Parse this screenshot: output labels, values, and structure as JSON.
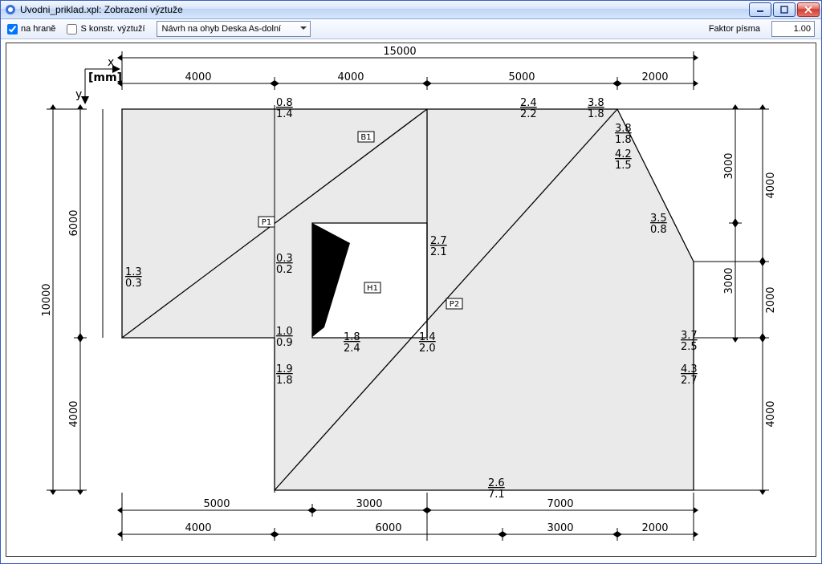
{
  "window": {
    "title": "Uvodni_priklad.xpl: Zobrazení výztuže"
  },
  "toolbar": {
    "edge_label": "na hraně",
    "edge_checked": true,
    "konstr_label": "S konstr. výztuží",
    "konstr_checked": false,
    "dropdown_value": "Návrh na ohyb Deska As-dolní",
    "factor_label": "Faktor písma",
    "factor_value": "1.00"
  },
  "axes": {
    "x": "x",
    "y": "y",
    "unit": "[mm]"
  },
  "dims_top_outer": {
    "total": "15000"
  },
  "dims_top": {
    "a": "4000",
    "b": "4000",
    "c": "5000",
    "d": "2000"
  },
  "dims_left": {
    "a": "6000",
    "b": "4000",
    "total": "10000"
  },
  "dims_bottom_mid": {
    "a": "5000",
    "b": "3000",
    "c": "7000"
  },
  "dims_bottom": {
    "a": "4000",
    "b": "6000",
    "c": "3000",
    "d": "2000"
  },
  "dims_right_outer": {
    "a": "4000",
    "b": "2000",
    "c": "4000"
  },
  "dims_right_inner": {
    "a": "3000",
    "b": "3000"
  },
  "labels": {
    "B1": "B1",
    "P1": "P1",
    "P2": "P2",
    "H1": "H1"
  },
  "ann": {
    "t1": {
      "u": "0.8",
      "l": "1.4"
    },
    "t2": {
      "u": "2.4",
      "l": "2.2"
    },
    "t3": {
      "u": "3.8",
      "l": "1.8"
    },
    "r1": {
      "u": "3.8",
      "l": "1.8"
    },
    "r2": {
      "u": "4.2",
      "l": "1.5"
    },
    "r3": {
      "u": "3.5",
      "l": "0.8"
    },
    "r4": {
      "u": "3.7",
      "l": "2.5"
    },
    "r5": {
      "u": "4.3",
      "l": "2.7"
    },
    "l1": {
      "u": "1.3",
      "l": "0.3"
    },
    "m1": {
      "u": "0.3",
      "l": "0.2"
    },
    "m2": {
      "u": "1.0",
      "l": "0.9"
    },
    "m3": {
      "u": "1.8",
      "l": "2.4"
    },
    "m4": {
      "u": "1.4",
      "l": "2.0"
    },
    "m5": {
      "u": "2.7",
      "l": "2.1"
    },
    "m6": {
      "u": "1.9",
      "l": "1.8"
    },
    "b1": {
      "u": "2.6",
      "l": "7.1"
    }
  }
}
